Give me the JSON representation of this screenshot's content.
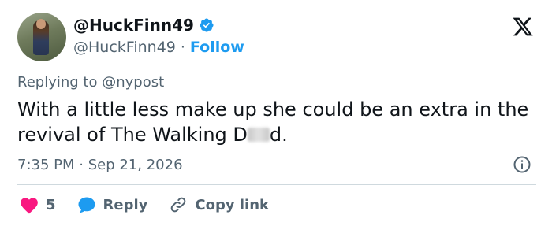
{
  "author": {
    "display_name": "@HuckFinn49",
    "handle": "@HuckFinn49",
    "separator": "·",
    "follow_label": "Follow",
    "verified": true
  },
  "reply_to": {
    "label": "Replying to",
    "mention": "@nypost"
  },
  "tweet": {
    "text_before_censor": "With a little less make up she could be an extra in the revival of The Walking D",
    "text_after_censor": "d."
  },
  "meta": {
    "time": "7:35 PM",
    "separator": "·",
    "date": "Sep 21, 2026"
  },
  "actions": {
    "like_count": "5",
    "reply_label": "Reply",
    "copy_link_label": "Copy link"
  },
  "icons": {
    "logo": "x-logo-icon",
    "verified": "verified-badge-icon",
    "info": "info-icon",
    "like": "heart-icon",
    "reply": "speech-bubble-icon",
    "copy": "link-icon"
  },
  "colors": {
    "accent": "#1d9bf0",
    "like": "#f91880",
    "muted": "#536471",
    "text": "#0f1419"
  }
}
